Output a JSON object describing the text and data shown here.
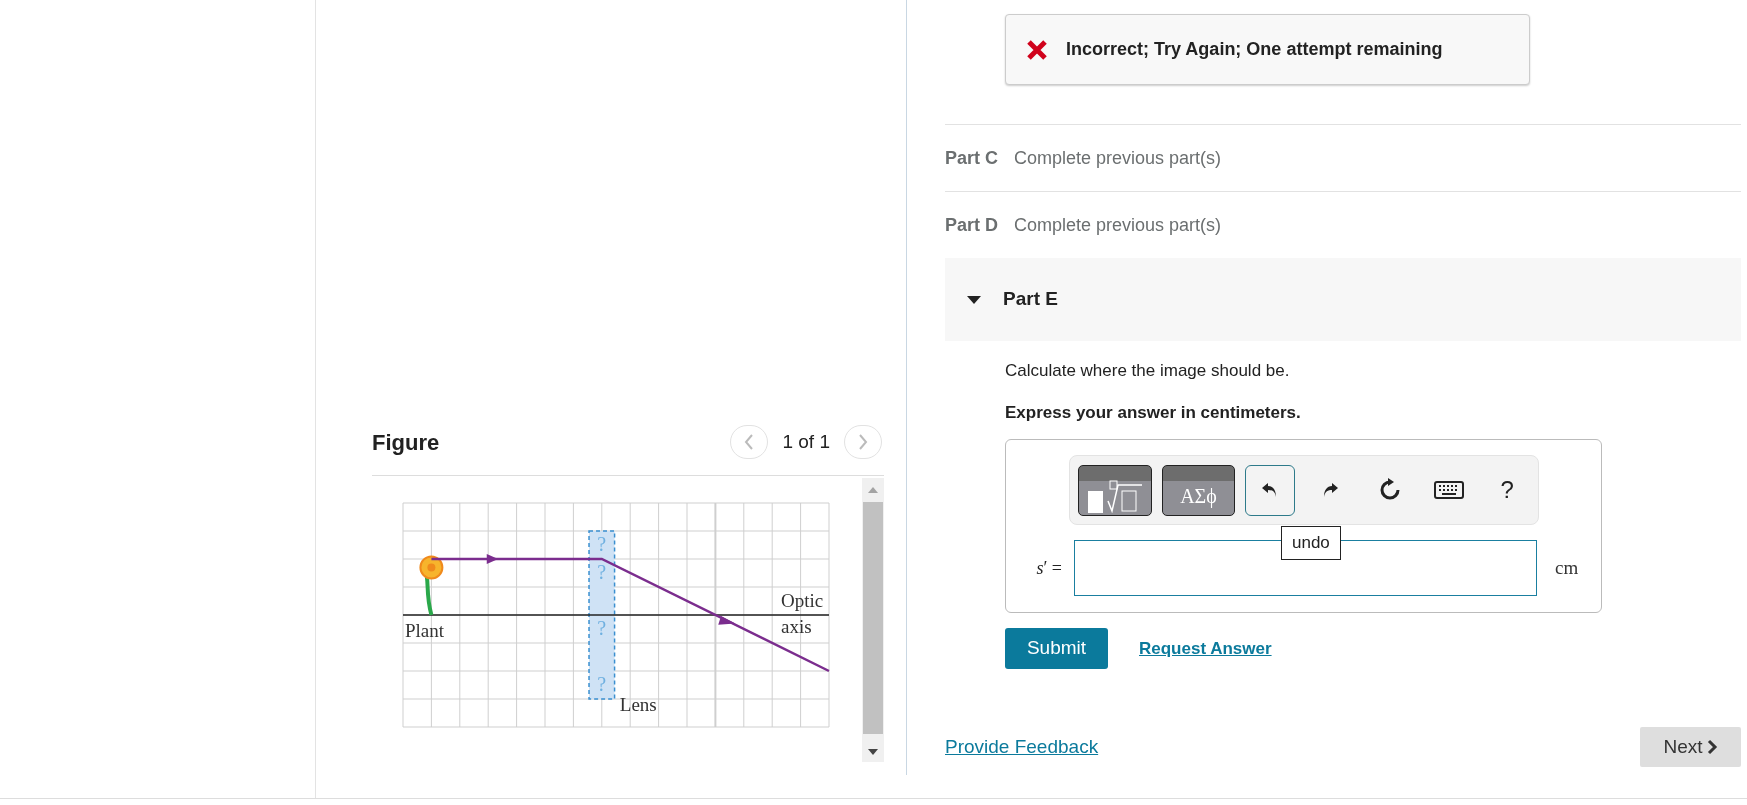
{
  "figure": {
    "title": "Figure",
    "pager": "1 of 1",
    "labels": [
      "Plant",
      "Optic",
      "axis",
      "Lens"
    ],
    "lens_marks": [
      "?",
      "?",
      "?",
      "?"
    ]
  },
  "feedback": {
    "kind": "incorrect",
    "message": "Incorrect; Try Again; One attempt remaining"
  },
  "parts": [
    {
      "label": "Part C",
      "status": "Complete previous part(s)",
      "expanded": false
    },
    {
      "label": "Part D",
      "status": "Complete previous part(s)",
      "expanded": false
    },
    {
      "label": "Part E",
      "expanded": true
    }
  ],
  "question": {
    "prompt": "Calculate where the image should be.",
    "instruction": "Express your answer in centimeters."
  },
  "toolbar": [
    {
      "kind": "templates",
      "focused": false
    },
    {
      "kind": "symbols",
      "label": "ΑΣϕ",
      "focused": false
    },
    {
      "kind": "undo",
      "focused": true
    },
    {
      "kind": "redo",
      "focused": false
    },
    {
      "kind": "reset",
      "focused": false
    },
    {
      "kind": "keyboard",
      "focused": false
    },
    {
      "kind": "help",
      "label": "?",
      "focused": false
    }
  ],
  "tooltip": "undo",
  "answer": {
    "variable": "*s*′ =",
    "unit": "cm"
  },
  "actions": {
    "submit": "Submit",
    "request": "Request Answer"
  },
  "footer": {
    "feedback_link": "Provide Feedback",
    "next": "Next"
  }
}
